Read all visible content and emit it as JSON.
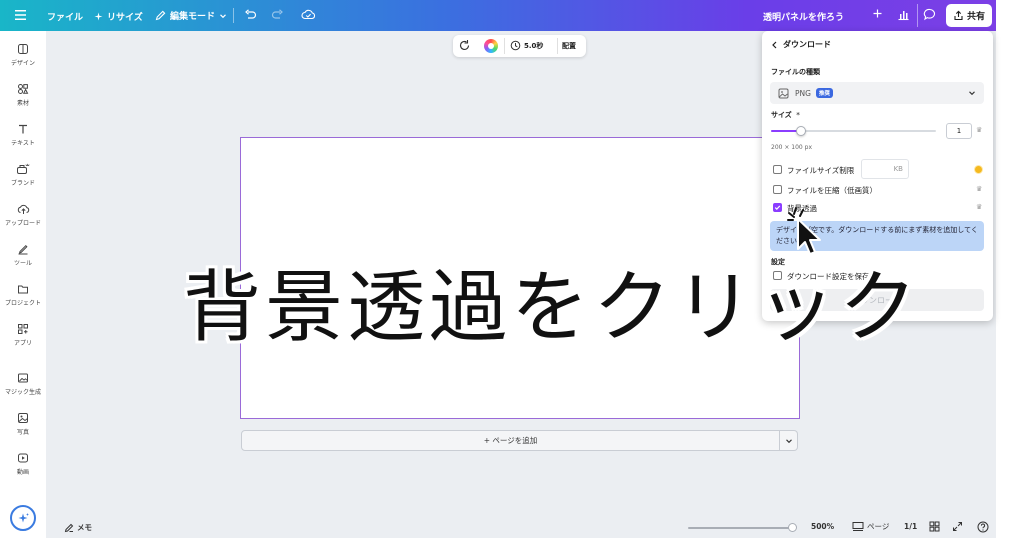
{
  "topbar": {
    "file_label": "ファイル",
    "resize_label": "リサイズ",
    "edit_mode_label": "編集モード",
    "doc_title": "透明パネルを作ろう",
    "share_label": "共有"
  },
  "sidebar": {
    "items": [
      {
        "label": "デザイン",
        "icon": "design-icon"
      },
      {
        "label": "素材",
        "icon": "elements-icon"
      },
      {
        "label": "テキスト",
        "icon": "text-icon"
      },
      {
        "label": "ブランド",
        "icon": "brand-icon"
      },
      {
        "label": "アップロード",
        "icon": "upload-icon"
      },
      {
        "label": "ツール",
        "icon": "draw-icon"
      },
      {
        "label": "プロジェクト",
        "icon": "folder-icon"
      },
      {
        "label": "アプリ",
        "icon": "apps-icon"
      },
      {
        "label": "マジック生成",
        "icon": "magic-media-icon"
      },
      {
        "label": "写真",
        "icon": "photo-icon"
      },
      {
        "label": "動画",
        "icon": "video-icon"
      }
    ]
  },
  "float_toolbar": {
    "duration": "5.0秒",
    "position_label": "配置"
  },
  "canvas": {
    "add_page_label": "+ ページを追加"
  },
  "download_panel": {
    "title": "ダウンロード",
    "file_type_label": "ファイルの種類",
    "file_type_value": "PNG",
    "recommended_badge": "推奨",
    "size_label": "サイズ",
    "size_required_mark": "*",
    "size_value": "1",
    "size_slider_fraction": 0.18,
    "dimensions": "200 × 100 px",
    "file_size_limit_label": "ファイルサイズ制限",
    "kb_unit": "KB",
    "compress_label": "ファイルを圧縮（低画質）",
    "transparent_bg_label": "背景透過",
    "transparent_bg_checked": true,
    "tooltip_text": "デザインが空です。ダウンロードする前にまず素材を追加してください。",
    "settings_label": "設定",
    "save_settings_label": "ダウンロード設定を保存",
    "download_button_label": "ダウンロード"
  },
  "bottombar": {
    "notes_label": "メモ",
    "zoom": "500%",
    "pages_label": "ページ",
    "page_count": "1/1"
  },
  "overlay": {
    "caption": "背景透過をクリック"
  },
  "colors": {
    "accent": "#8b3dff",
    "topbar_start": "#19b6c8",
    "topbar_end": "#7c3fe6",
    "page_border": "#9a6ad8",
    "badge": "#3b68e0",
    "tooltip_bg": "#bcd5f7"
  }
}
